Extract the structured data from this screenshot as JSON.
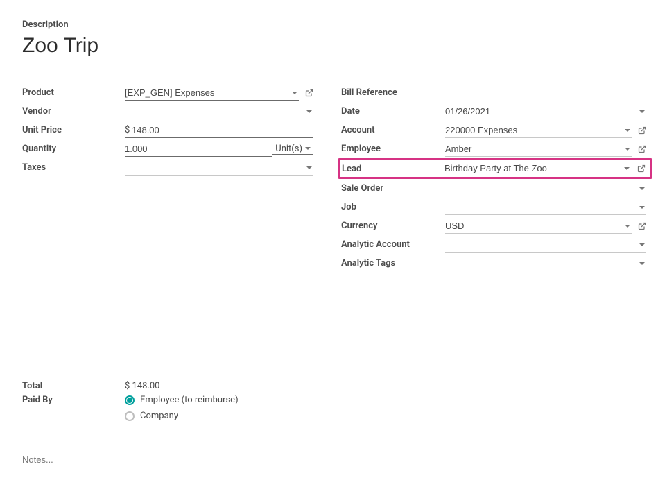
{
  "header": {
    "description_label": "Description",
    "title": "Zoo Trip"
  },
  "left": {
    "product": {
      "label": "Product",
      "value": "[EXP_GEN] Expenses"
    },
    "vendor": {
      "label": "Vendor",
      "value": ""
    },
    "unit_price": {
      "label": "Unit Price",
      "currency": "$",
      "value": "148.00"
    },
    "quantity": {
      "label": "Quantity",
      "value": "1.000",
      "uom": "Unit(s)"
    },
    "taxes": {
      "label": "Taxes",
      "value": ""
    }
  },
  "right": {
    "bill_reference": {
      "label": "Bill Reference",
      "value": ""
    },
    "date": {
      "label": "Date",
      "value": "01/26/2021"
    },
    "account": {
      "label": "Account",
      "value": "220000 Expenses"
    },
    "employee": {
      "label": "Employee",
      "value": "Amber"
    },
    "lead": {
      "label": "Lead",
      "value": "Birthday Party at The Zoo"
    },
    "sale_order": {
      "label": "Sale Order",
      "value": ""
    },
    "job": {
      "label": "Job",
      "value": ""
    },
    "currency": {
      "label": "Currency",
      "value": "USD"
    },
    "analytic_account": {
      "label": "Analytic Account",
      "value": ""
    },
    "analytic_tags": {
      "label": "Analytic Tags",
      "value": ""
    }
  },
  "bottom": {
    "total": {
      "label": "Total",
      "value": "$ 148.00"
    },
    "paid_by": {
      "label": "Paid By",
      "options": {
        "employee": "Employee (to reimburse)",
        "company": "Company"
      },
      "selected": "employee"
    },
    "notes_placeholder": "Notes..."
  }
}
